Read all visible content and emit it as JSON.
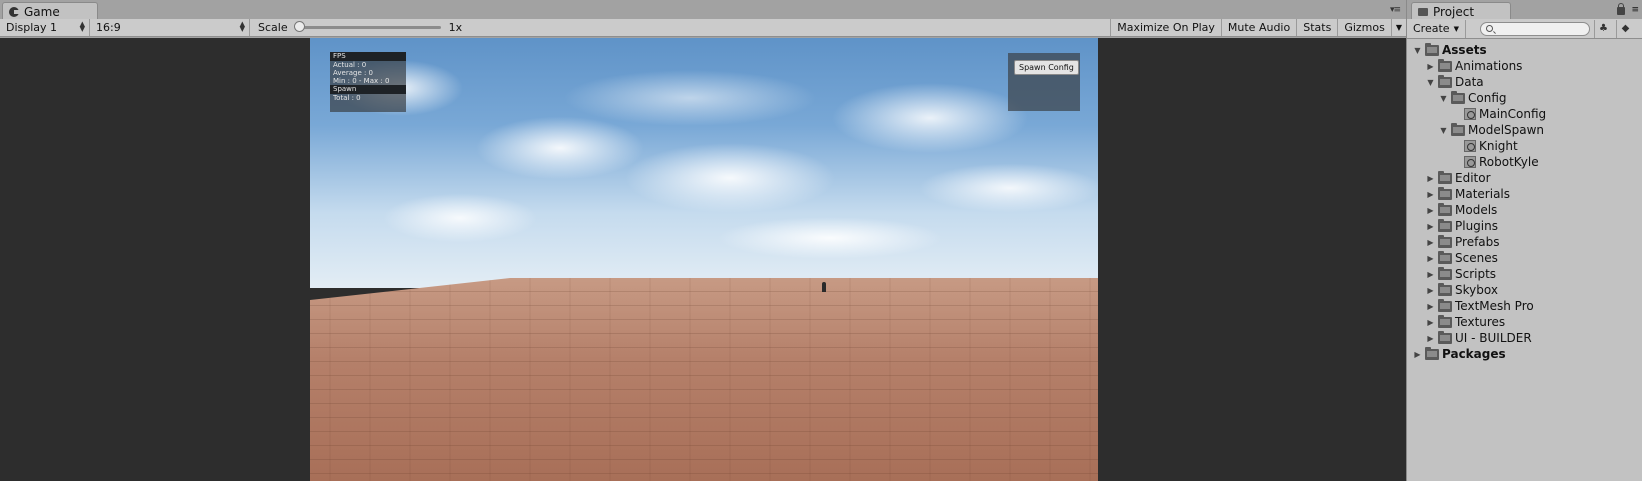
{
  "game": {
    "tab_label": "Game",
    "display": "Display 1",
    "aspect": "16:9",
    "scale_label": "Scale",
    "scale_value": "1x",
    "scale_level": 0.0,
    "buttons": [
      "Maximize On Play",
      "Mute Audio",
      "Stats",
      "Gizmos"
    ],
    "menu_glyph": "▾≡"
  },
  "overlay": {
    "fps_header": "FPS",
    "actual": "Actual : 0",
    "average": "Average : 0",
    "minmax": "Min : 0 - Max : 0",
    "spawn_header": "Spawn",
    "total": "Total : 0",
    "spawn_config_button": "Spawn Config"
  },
  "project": {
    "tab_label": "Project",
    "create_label": "Create",
    "tree": [
      {
        "label": "Assets",
        "depth": 0,
        "expanded": true,
        "kind": "folder",
        "bold": true
      },
      {
        "label": "Animations",
        "depth": 1,
        "expanded": false,
        "kind": "folder"
      },
      {
        "label": "Data",
        "depth": 1,
        "expanded": true,
        "kind": "folder"
      },
      {
        "label": "Config",
        "depth": 2,
        "expanded": true,
        "kind": "folder"
      },
      {
        "label": "MainConfig",
        "depth": 3,
        "kind": "asset"
      },
      {
        "label": "ModelSpawn",
        "depth": 2,
        "expanded": true,
        "kind": "folder"
      },
      {
        "label": "Knight",
        "depth": 3,
        "kind": "asset"
      },
      {
        "label": "RobotKyle",
        "depth": 3,
        "kind": "asset"
      },
      {
        "label": "Editor",
        "depth": 1,
        "expanded": false,
        "kind": "folder"
      },
      {
        "label": "Materials",
        "depth": 1,
        "expanded": false,
        "kind": "folder"
      },
      {
        "label": "Models",
        "depth": 1,
        "expanded": false,
        "kind": "folder"
      },
      {
        "label": "Plugins",
        "depth": 1,
        "expanded": false,
        "kind": "folder"
      },
      {
        "label": "Prefabs",
        "depth": 1,
        "expanded": false,
        "kind": "folder"
      },
      {
        "label": "Scenes",
        "depth": 1,
        "expanded": false,
        "kind": "folder"
      },
      {
        "label": "Scripts",
        "depth": 1,
        "expanded": false,
        "kind": "folder"
      },
      {
        "label": "Skybox",
        "depth": 1,
        "expanded": false,
        "kind": "folder"
      },
      {
        "label": "TextMesh Pro",
        "depth": 1,
        "expanded": false,
        "kind": "folder"
      },
      {
        "label": "Textures",
        "depth": 1,
        "expanded": false,
        "kind": "folder"
      },
      {
        "label": "UI - BUILDER",
        "depth": 1,
        "expanded": false,
        "kind": "folder"
      },
      {
        "label": "Packages",
        "depth": 0,
        "expanded": false,
        "kind": "folder",
        "bold": true
      }
    ]
  },
  "colors": {
    "panel_bg": "#c2c2c2",
    "viewport_bg": "#2d2d2d",
    "floor": "#b07a63",
    "sky": "#79a8d6"
  }
}
